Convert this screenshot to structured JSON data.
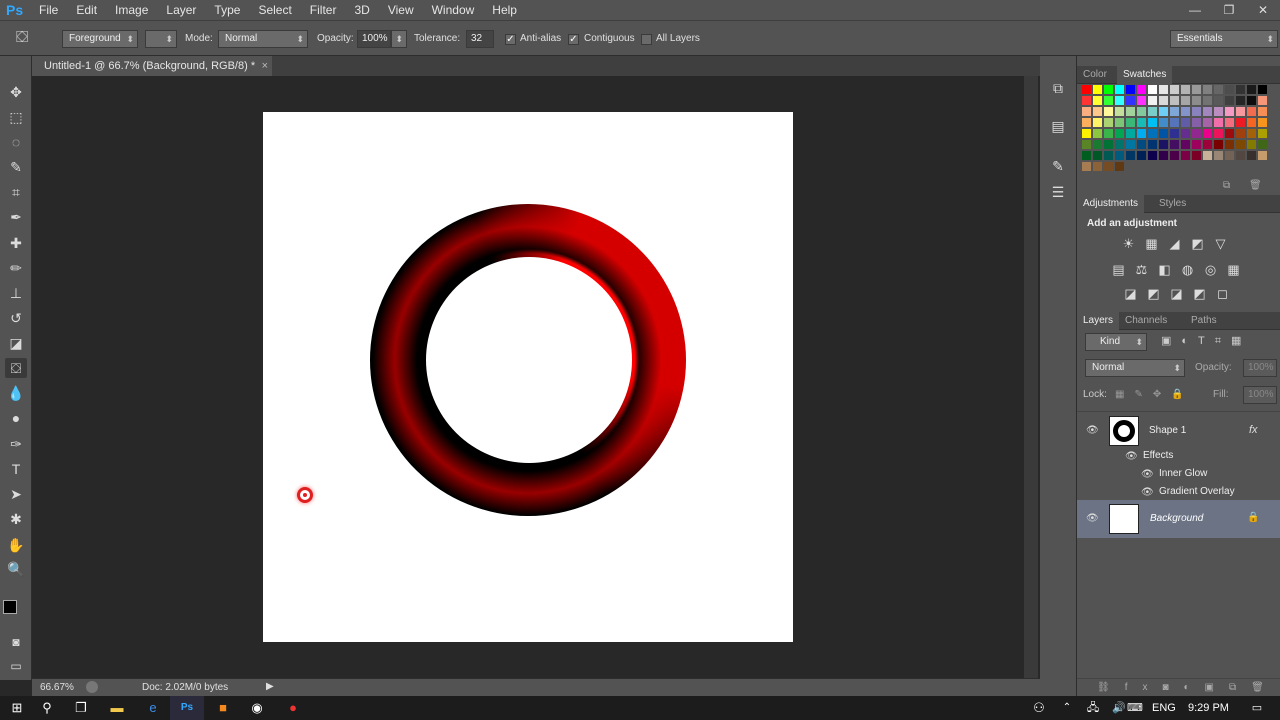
{
  "app": {
    "logo": "Ps"
  },
  "menu": [
    "File",
    "Edit",
    "Image",
    "Layer",
    "Type",
    "Select",
    "Filter",
    "3D",
    "View",
    "Window",
    "Help"
  ],
  "window_controls": [
    "—",
    "❐",
    "✕"
  ],
  "options_bar": {
    "fill_source": "Foreground",
    "mode_label": "Mode:",
    "mode_value": "Normal",
    "opacity_label": "Opacity:",
    "opacity_value": "100%",
    "tolerance_label": "Tolerance:",
    "tolerance_value": "32",
    "antialias_label": "Anti-alias",
    "antialias_checked": true,
    "contiguous_label": "Contiguous",
    "contiguous_checked": true,
    "all_layers_label": "All Layers",
    "all_layers_checked": false,
    "workspace": "Essentials"
  },
  "document": {
    "tab_title": "Untitled-1 @ 66.7% (Background, RGB/8) *",
    "tab_close": "×"
  },
  "status": {
    "zoom": "66.67%",
    "doc_info": "Doc: 2.02M/0 bytes"
  },
  "color_panel": {
    "tabs": [
      "Color",
      "Swatches"
    ],
    "active_tab": "Swatches",
    "swatch_colors": [
      "#ff0000",
      "#ffff00",
      "#00ff00",
      "#00ffff",
      "#0000ff",
      "#ff00ff",
      "#ffffff",
      "#e6e6e6",
      "#cccccc",
      "#b3b3b3",
      "#999999",
      "#808080",
      "#666666",
      "#4d4d4d",
      "#333333",
      "#1a1a1a",
      "#000000",
      "#ff3333",
      "#ffff33",
      "#33ff33",
      "#33ffff",
      "#3333ff",
      "#ff33ff",
      "#f2f2f2",
      "#d9d9d9",
      "#bfbfbf",
      "#a6a6a6",
      "#8c8c8c",
      "#737373",
      "#595959",
      "#404040",
      "#262626",
      "#0d0d0d",
      "#f7977a",
      "#f9ad81",
      "#fdc68a",
      "#fff79a",
      "#c4df9b",
      "#a3d39c",
      "#82ca9d",
      "#7bcdc8",
      "#6ecff6",
      "#7ea7d8",
      "#8493ca",
      "#8882be",
      "#a187be",
      "#bc8dbf",
      "#f49ac2",
      "#f6989d",
      "#f26c4f",
      "#f68e55",
      "#fbaf5c",
      "#fff467",
      "#acd372",
      "#7cc576",
      "#3bb878",
      "#1abbb4",
      "#00bff3",
      "#438cca",
      "#5574b9",
      "#605ca8",
      "#855fa8",
      "#a763a8",
      "#f06ea9",
      "#f26d7d",
      "#ed1c24",
      "#f26522",
      "#f7941d",
      "#fff200",
      "#8dc73f",
      "#39b54a",
      "#00a651",
      "#00a99d",
      "#00aeef",
      "#0072bc",
      "#0054a6",
      "#2e3192",
      "#662d91",
      "#92278f",
      "#ec008c",
      "#ed145b",
      "#9e0b0f",
      "#a0410d",
      "#a36209",
      "#aba000",
      "#598527",
      "#197b30",
      "#007236",
      "#00746b",
      "#0076a3",
      "#004b80",
      "#003471",
      "#1b1464",
      "#440e62",
      "#630460",
      "#9e005d",
      "#9e0039",
      "#790000",
      "#7b2e00",
      "#7d4900",
      "#827b00",
      "#406618",
      "#005e20",
      "#005826",
      "#005952",
      "#005b7f",
      "#003663",
      "#002157",
      "#0d004c",
      "#32004b",
      "#4b0049",
      "#7b0046",
      "#7a0026",
      "#c7b299",
      "#998675",
      "#736357",
      "#534741",
      "#37302d",
      "#c69c6d",
      "#a67c52",
      "#8c6239",
      "#754c24",
      "#603913"
    ]
  },
  "adjustments_panel": {
    "tabs": [
      "Adjustments",
      "Styles"
    ],
    "active_tab": "Adjustments",
    "heading": "Add an adjustment",
    "row1": [
      "☀",
      "▦",
      "◢",
      "◩",
      "▽"
    ],
    "row2": [
      "▤",
      "⚖",
      "◧",
      "◍",
      "◎",
      "▦"
    ],
    "row3": [
      "◪",
      "◩",
      "◪",
      "◩",
      "◻"
    ]
  },
  "layers_panel": {
    "tabs": [
      "Layers",
      "Channels",
      "Paths"
    ],
    "active_tab": "Layers",
    "filter_kind": "Kind",
    "blend_mode": "Normal",
    "opacity_label": "Opacity:",
    "opacity_value": "100%",
    "lock_label": "Lock:",
    "fill_label": "Fill:",
    "fill_value": "100%",
    "layers": [
      {
        "name": "Shape 1",
        "fx": "fx",
        "effects_label": "Effects",
        "effects": [
          "Inner Glow",
          "Gradient Overlay"
        ]
      },
      {
        "name": "Background",
        "lock": "🔒"
      }
    ]
  },
  "taskbar": {
    "language": "ENG",
    "time": "9:29 PM"
  }
}
